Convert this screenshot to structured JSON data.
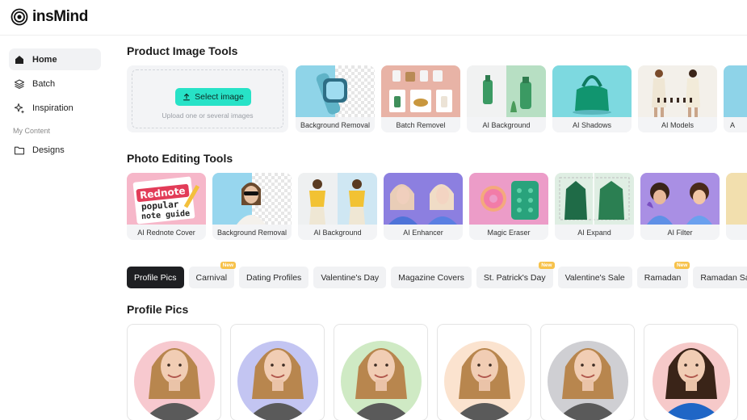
{
  "app": {
    "name": "insMind"
  },
  "sidebar": {
    "items": [
      {
        "label": "Home",
        "icon": "home-icon",
        "active": true
      },
      {
        "label": "Batch",
        "icon": "layers-icon",
        "active": false
      },
      {
        "label": "Inspiration",
        "icon": "sparkle-icon",
        "active": false
      }
    ],
    "section_label": "My Content",
    "content_items": [
      {
        "label": "Designs",
        "icon": "folder-icon"
      }
    ]
  },
  "product_tools": {
    "title": "Product Image Tools",
    "upload": {
      "button_label": "Select image",
      "hint": "Upload one or several images"
    },
    "tools": [
      {
        "label": "Background Removal"
      },
      {
        "label": "Batch Removel"
      },
      {
        "label": "AI Background"
      },
      {
        "label": "AI Shadows"
      },
      {
        "label": "AI Models"
      },
      {
        "label": "A"
      }
    ]
  },
  "photo_tools": {
    "title": "Photo Editing Tools",
    "rednote_text": [
      "Rednote",
      "popular",
      "note guide"
    ],
    "tools": [
      {
        "label": "AI Rednote Cover"
      },
      {
        "label": "Background Removal"
      },
      {
        "label": "AI Background"
      },
      {
        "label": "AI Enhancer"
      },
      {
        "label": "Magic Eraser"
      },
      {
        "label": "AI Expand"
      },
      {
        "label": "AI Filter"
      },
      {
        "label": ""
      }
    ]
  },
  "templates": {
    "chips": [
      {
        "label": "Profile Pics",
        "active": true,
        "badge": ""
      },
      {
        "label": "Carnival",
        "active": false,
        "badge": "New"
      },
      {
        "label": "Dating Profiles",
        "active": false,
        "badge": ""
      },
      {
        "label": "Valentine's Day",
        "active": false,
        "badge": ""
      },
      {
        "label": "Magazine Covers",
        "active": false,
        "badge": ""
      },
      {
        "label": "St. Patrick's Day",
        "active": false,
        "badge": "New"
      },
      {
        "label": "Valentine's Sale",
        "active": false,
        "badge": ""
      },
      {
        "label": "Ramadan",
        "active": false,
        "badge": "New"
      },
      {
        "label": "Ramadan Sales",
        "active": false,
        "badge": ""
      }
    ],
    "section_title": "Profile Pics",
    "pics": [
      {
        "circle_color": "#f7c9cf"
      },
      {
        "circle_color": "#c3c5f2"
      },
      {
        "circle_color": "#cfeac4"
      },
      {
        "circle_color": "#fbe3cf"
      },
      {
        "circle_color": "#cfcfd3"
      },
      {
        "circle_color": "#f6c9c9"
      }
    ]
  },
  "colors": {
    "accent": "#27e2c7",
    "badge": "#f7c24b",
    "active_chip": "#1e1f22"
  }
}
